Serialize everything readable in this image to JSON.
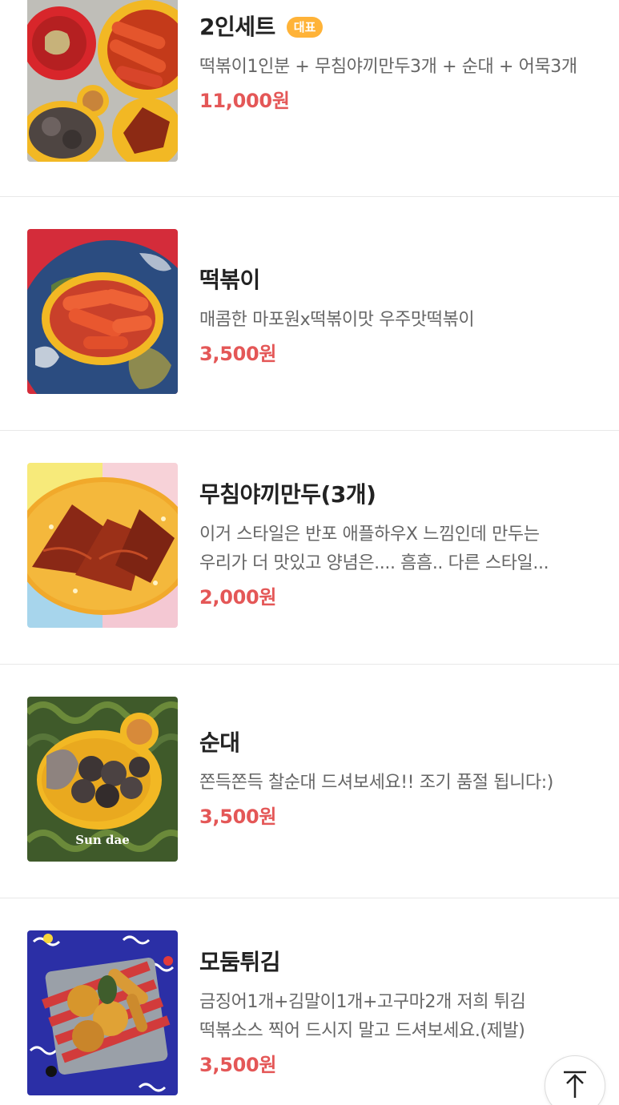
{
  "menu": {
    "items": [
      {
        "name": "2인세트",
        "badge": "대표",
        "description": "떡볶이1인분 + 무침야끼만두3개 + 순대 + 어묵3개",
        "price": "11,000원",
        "image_icon": "set-food-image"
      },
      {
        "name": "떡볶이",
        "description": "매콤한 마포원x떡볶이맛 우주맛떡볶이",
        "price": "3,500원",
        "image_icon": "tteokbokki-image"
      },
      {
        "name": "무침야끼만두(3개)",
        "description": "이거 스타일은 반포 애플하우X 느낌인데 만두는 우리가 더 맛있고 양념은.... 흠흠.. 다른 스타일...",
        "price": "2,000원",
        "image_icon": "dumpling-image"
      },
      {
        "name": "순대",
        "description": "쫀득쫀득 찰순대 드셔보세요!! 조기 품절 됩니다:)",
        "price": "3,500원",
        "image_icon": "sundae-image",
        "image_caption": "Sun dae"
      },
      {
        "name": "모둠튀김",
        "description": "금징어1개+김말이1개+고구마2개 저희 튀김 떡볶소스 찍어 드시지 말고 드셔보세요.(제발)",
        "price": "3,500원",
        "image_icon": "fried-food-image"
      }
    ]
  },
  "scroll_top": {
    "icon": "arrow-up-icon"
  },
  "colors": {
    "price": "#e45757",
    "badge": "#ffb338",
    "name": "#222222",
    "description": "#666666",
    "divider": "#e8e8e8"
  }
}
